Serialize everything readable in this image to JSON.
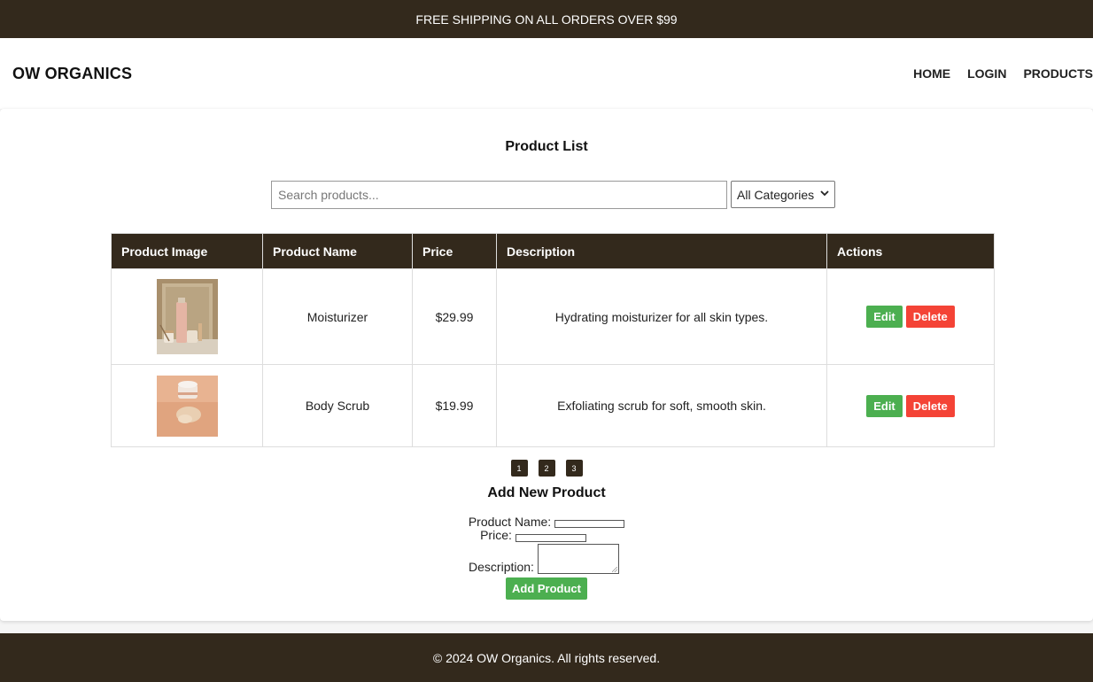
{
  "promo": {
    "text": "FREE SHIPPING ON ALL ORDERS OVER $99"
  },
  "header": {
    "logo": "OW ORGANICS",
    "nav": [
      "HOME",
      "LOGIN",
      "PRODUCTS"
    ]
  },
  "main": {
    "title": "Product List",
    "search": {
      "placeholder": "Search products...",
      "value": ""
    },
    "category": {
      "selected": "All Categories"
    },
    "table": {
      "headers": [
        "Product Image",
        "Product Name",
        "Price",
        "Description",
        "Actions"
      ],
      "rows": [
        {
          "name": "Moisturizer",
          "price": "$29.99",
          "description": "Hydrating moisturizer for all skin types.",
          "edit": "Edit",
          "delete": "Delete"
        },
        {
          "name": "Body Scrub",
          "price": "$19.99",
          "description": "Exfoliating scrub for soft, smooth skin.",
          "edit": "Edit",
          "delete": "Delete"
        }
      ]
    },
    "pagination": [
      "1",
      "2",
      "3"
    ]
  },
  "form": {
    "title": "Add New Product",
    "name_label": "Product Name:",
    "price_label": "Price:",
    "description_label": "Description:",
    "submit_label": "Add Product"
  },
  "footer": {
    "text": "© 2024 OW Organics. All rights reserved."
  },
  "colors": {
    "brand_dark": "#33291c",
    "success": "#4caf50",
    "danger": "#f44336"
  }
}
